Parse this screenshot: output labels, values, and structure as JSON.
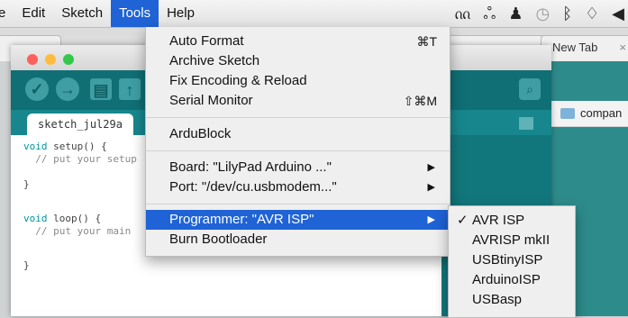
{
  "menubar": {
    "items": [
      "e",
      "Edit",
      "Sketch",
      "Tools",
      "Help"
    ],
    "active_index": 3
  },
  "status_icons": [
    "creative-cloud-icon",
    "handshake-icon",
    "ghost-icon",
    "time-machine-icon",
    "bluetooth-icon",
    "wifi-icon",
    "volume-icon"
  ],
  "browser": {
    "tabs": [
      {
        "label": "New Tab",
        "close": "×"
      }
    ]
  },
  "finder": {
    "folder_label": "compan"
  },
  "arduino": {
    "sketch_tab": "sketch_jul29a",
    "code": [
      {
        "kw": "void",
        "rest": " setup() {"
      },
      {
        "cm": "  // put your setup"
      },
      {
        "plain": ""
      },
      {
        "plain": "}"
      },
      {
        "plain": ""
      },
      {
        "kw": "void",
        "rest": " loop() {"
      },
      {
        "cm": "  // put your main"
      },
      {
        "plain": ""
      },
      {
        "plain": "}"
      }
    ]
  },
  "tools_menu": {
    "items": [
      {
        "label": "Auto Format",
        "shortcut": "⌘T"
      },
      {
        "label": "Archive Sketch",
        "shortcut": ""
      },
      {
        "label": "Fix Encoding & Reload",
        "shortcut": ""
      },
      {
        "label": "Serial Monitor",
        "shortcut": "⇧⌘M"
      },
      {
        "label": "ArduBlock",
        "shortcut": ""
      },
      {
        "label": "Board: \"LilyPad Arduino ...\"",
        "submenu": true
      },
      {
        "label": "Port: \"/dev/cu.usbmodem...\"",
        "submenu": true
      },
      {
        "label": "Programmer: \"AVR ISP\"",
        "submenu": true,
        "highlighted": true
      },
      {
        "label": "Burn Bootloader",
        "shortcut": ""
      }
    ]
  },
  "programmer_submenu": {
    "items": [
      {
        "label": "AVR ISP",
        "checked": true
      },
      {
        "label": "AVRISP mkII",
        "checked": false
      },
      {
        "label": "USBtinyISP",
        "checked": false
      },
      {
        "label": "ArduinoISP",
        "checked": false
      },
      {
        "label": "USBasp",
        "checked": false
      }
    ],
    "check_glyph": "✓"
  },
  "colors": {
    "highlight": "#1f63d6",
    "arduino_teal": "#0f6f75"
  }
}
